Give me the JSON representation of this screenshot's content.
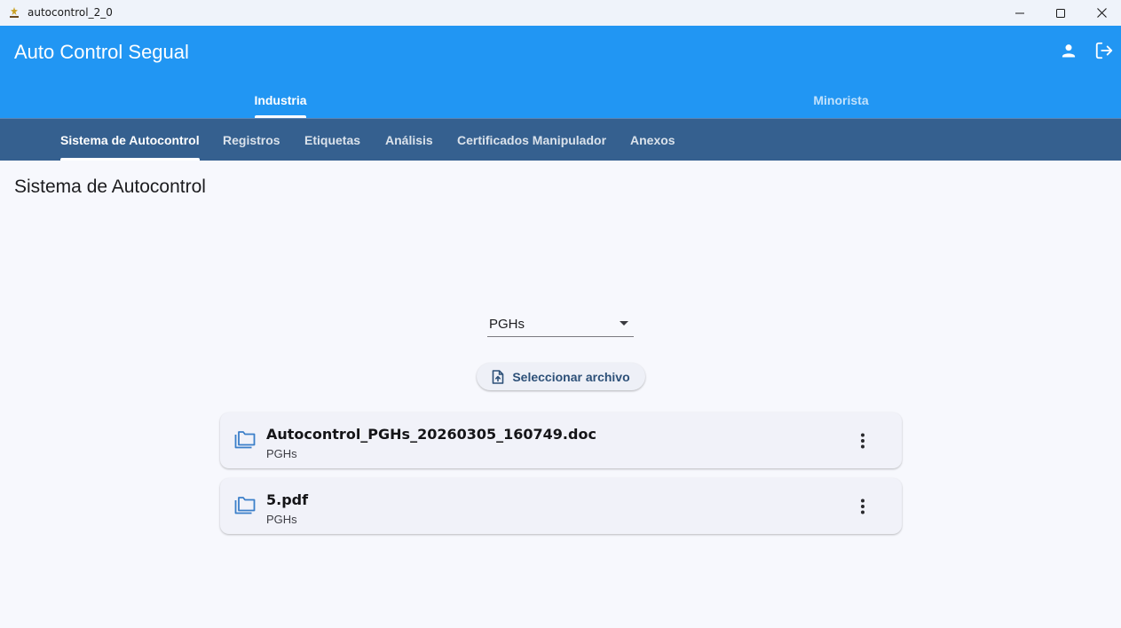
{
  "window": {
    "title": "autocontrol_2_0",
    "icons": [
      "app-icon",
      "minimize-icon",
      "maximize-icon",
      "close-icon"
    ]
  },
  "appbar": {
    "title": "Auto Control Segual",
    "icons": [
      "person-icon",
      "logout-icon"
    ],
    "color": "#2196f3"
  },
  "main_tabs": [
    {
      "label": "Industria",
      "active": true
    },
    {
      "label": "Minorista",
      "active": false
    }
  ],
  "sub_tabs": [
    {
      "label": "Sistema de Autocontrol",
      "active": true
    },
    {
      "label": "Registros",
      "active": false
    },
    {
      "label": "Etiquetas",
      "active": false
    },
    {
      "label": "Análisis",
      "active": false
    },
    {
      "label": "Certificados Manipulador",
      "active": false
    },
    {
      "label": "Anexos",
      "active": false
    }
  ],
  "subbar_color": "#35608f",
  "content": {
    "page_title": "Sistema de Autocontrol",
    "category_select": {
      "value": "PGHs",
      "icon": "dropdown-arrow-icon"
    },
    "upload_button": {
      "label": "Seleccionar archivo",
      "icon": "upload-file-icon"
    },
    "files": [
      {
        "name": "Autocontrol_PGHs_20260305_160749.doc",
        "category": "PGHs",
        "icon": "folder-icon"
      },
      {
        "name": "5.pdf",
        "category": "PGHs",
        "icon": "folder-icon"
      }
    ]
  }
}
